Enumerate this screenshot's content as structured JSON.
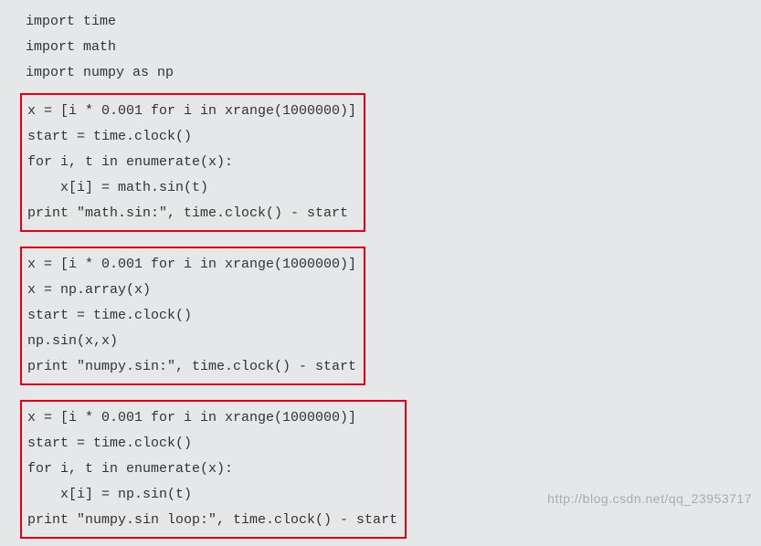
{
  "imports": {
    "line1": "import time",
    "line2": "import math",
    "line3": "import numpy as np"
  },
  "block1": {
    "l1": "x = [i * 0.001 for i in xrange(1000000)]",
    "l2": "start = time.clock()",
    "l3": "for i, t in enumerate(x):",
    "l4": "    x[i] = math.sin(t)",
    "l5": "print \"math.sin:\", time.clock() - start"
  },
  "block2": {
    "l1": "x = [i * 0.001 for i in xrange(1000000)]",
    "l2": "x = np.array(x)",
    "l3": "start = time.clock()",
    "l4": "np.sin(x,x)",
    "l5": "print \"numpy.sin:\", time.clock() - start"
  },
  "block3": {
    "l1": "x = [i * 0.001 for i in xrange(1000000)]",
    "l2": "start = time.clock()",
    "l3": "for i, t in enumerate(x):",
    "l4": "    x[i] = np.sin(t)",
    "l5": "print \"numpy.sin loop:\", time.clock() - start"
  },
  "watermark": "http://blog.csdn.net/qq_23953717"
}
